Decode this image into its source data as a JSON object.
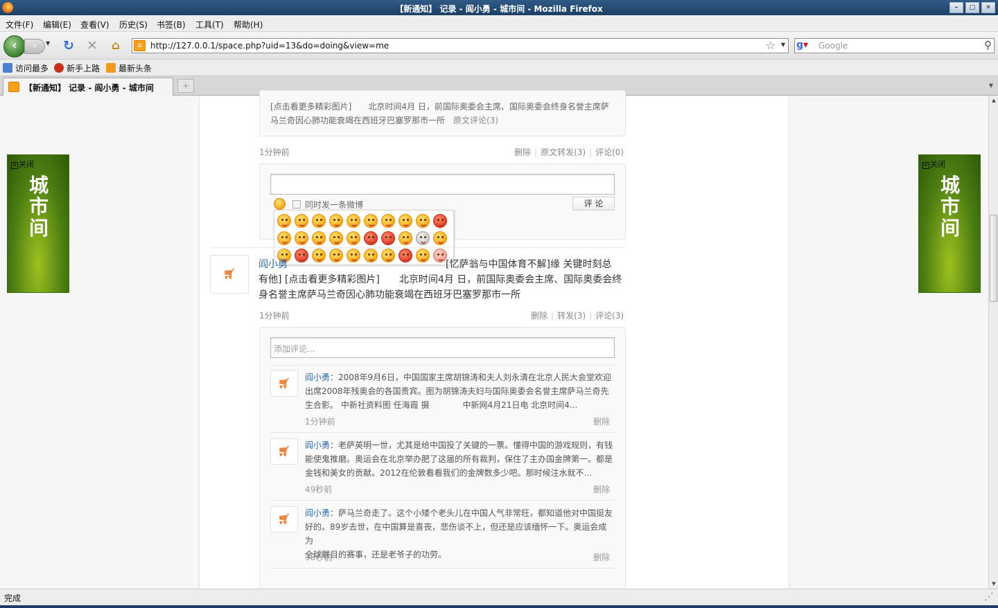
{
  "window": {
    "title": "【新通知】 记录 - 阎小勇 - 城市间 - Mozilla Firefox",
    "minimize": "–",
    "maximize": "□",
    "close": "✕"
  },
  "menu": [
    "文件(F)",
    "编辑(E)",
    "查看(V)",
    "历史(S)",
    "书签(B)",
    "工具(T)",
    "帮助(H)"
  ],
  "nav": {
    "url": "http://127.0.0.1/space.php?uid=13&do=doing&view=me",
    "search_placeholder": "Google"
  },
  "bookmarks": [
    "访问最多",
    "新手上路",
    "最新头条"
  ],
  "tab": {
    "title": "【新通知】 记录 - 阎小勇 - 城市间"
  },
  "ad": {
    "close": "关闭",
    "brand_lines": [
      "城",
      "市",
      "间"
    ]
  },
  "post1": {
    "quote_line1": "[点击看更多精彩图片]　　北京时间4月 日，前国际奥委会主席、国际奥委会终身名誉主席萨",
    "quote_line2": "马兰奇因心肺功能衰竭在西班牙巴塞罗那市一所",
    "quote_comments": "原文评论(3)",
    "time": "1分钟前",
    "delete": "删除",
    "repost": "原文转发(3)",
    "comments": "评论(0)",
    "sync_label": "同时发一条微博",
    "submit": "评 论"
  },
  "post2": {
    "author": "阎小勇",
    "text_line1_tail": "[忆萨翁与中国体育不解]缘 关键时刻总",
    "text_line2": "有他] [点击看更多精彩图片]　　北京时间4月 日，前国际奥委会主席、国际奥委会终",
    "text_line3": "身名誉主席萨马兰奇因心肺功能衰竭在西班牙巴塞罗那市一所",
    "time": "1分钟前",
    "delete": "删除",
    "repost": "转发(3)",
    "comments": "评论(3)",
    "comment_placeholder": "添加评论..."
  },
  "comments": [
    {
      "name": "阎小勇",
      "line1": "：2008年9月6日，中国国家主席胡锦涛和夫人刘永清在北京人民大会堂欢迎",
      "line2": "出席2008年残奥会的各国贵宾。图为胡锦涛夫妇与国际奥委会名誉主席萨马兰奇先",
      "line3": "生合影。 中新社资料图 任海霞 摄　　　　中新网4月21日电 北京时间4...",
      "time": "1分钟前",
      "delete": "删除"
    },
    {
      "name": "阎小勇",
      "line1": "：老萨英明一世，尤其是给中国投了关键的一票。懂得中国的游戏规则，有钱",
      "line2": "能使鬼推磨。奥运会在北京举办肥了这届的所有裁判，保住了主办国金牌第一。都是",
      "line3": "金钱和美女的贡献。2012在伦敦看看我们的金牌数多少吧。那时候注水就不...",
      "time": "49秒前",
      "delete": "删除"
    },
    {
      "name": "阎小勇",
      "line1": "：萨马兰奇走了。这个小矮个老头儿在中国人气非常旺，都知道他对中国挺友",
      "line2": "好的。89岁去世，在中国算是喜丧，悲伤谈不上，但还是应该缅怀一下。奥运会成为",
      "line3": "全球瞩目的赛事，还是老爷子的功劳。",
      "time": "38秒前",
      "delete": "删除"
    }
  ],
  "status": {
    "text": "完成"
  }
}
